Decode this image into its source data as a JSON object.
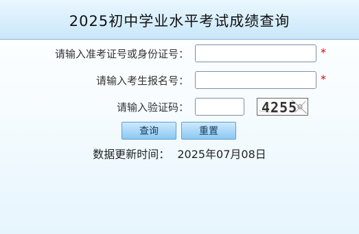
{
  "header": {
    "title": "2025初中学业水平考试成绩查询"
  },
  "form": {
    "exam_id_label": "请输入准考证号或身份证号：",
    "exam_id_value": "",
    "reg_id_label": "请输入考生报名号：",
    "reg_id_value": "",
    "captcha_label": "请输入验证码：",
    "captcha_value": "",
    "captcha_code": "4255",
    "required_mark": "*"
  },
  "buttons": {
    "query": "查询",
    "reset": "重置"
  },
  "update": {
    "label": "数据更新时间：",
    "date": "2025年07月08日"
  },
  "colors": {
    "required": "#e00000",
    "header_bg": "#c9e7f9",
    "button_bg": "#8cc8f3"
  }
}
